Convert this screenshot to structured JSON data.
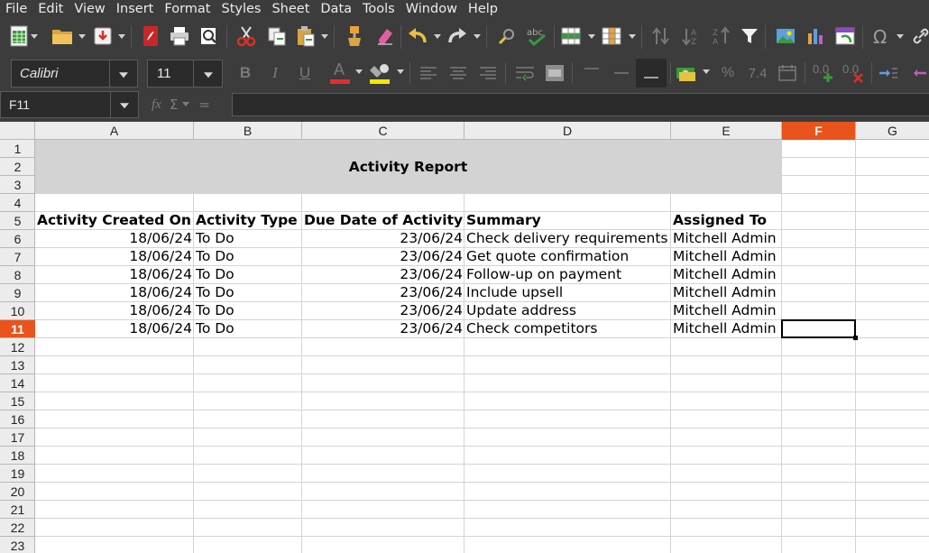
{
  "menu": [
    "File",
    "Edit",
    "View",
    "Insert",
    "Format",
    "Styles",
    "Sheet",
    "Data",
    "Tools",
    "Window",
    "Help"
  ],
  "toolbar": {
    "font_name": "Calibri",
    "font_size": "11",
    "bold": "B",
    "italic": "I",
    "underline": "U",
    "font_color_letter": "A",
    "font_color": "#e0302d",
    "highlight_color": "#f6e600",
    "currency": "%",
    "decimal": "7.4",
    "add_decimal": "0.0",
    "remove_decimal": "0.0"
  },
  "formula_bar": {
    "name_box": "F11",
    "fx": "fx",
    "sum": "Σ",
    "equals": "=",
    "content": ""
  },
  "columns": [
    "A",
    "B",
    "C",
    "D",
    "E",
    "F",
    "G"
  ],
  "selected_column": "F",
  "rows": [
    "1",
    "2",
    "3",
    "4",
    "5",
    "6",
    "7",
    "8",
    "9",
    "10",
    "11",
    "12",
    "13",
    "14",
    "15",
    "16",
    "17",
    "18",
    "19",
    "20",
    "21",
    "22",
    "23"
  ],
  "selected_row": "11",
  "sheet": {
    "title": "Activity Report",
    "headers": [
      "Activity Created On",
      "Activity Type",
      "Due Date of Activity",
      "Summary",
      "Assigned To"
    ],
    "records": [
      [
        "18/06/24",
        "To Do",
        "23/06/24",
        "Check delivery requirements",
        "Mitchell Admin"
      ],
      [
        "18/06/24",
        "To Do",
        "23/06/24",
        "Get quote confirmation",
        "Mitchell Admin"
      ],
      [
        "18/06/24",
        "To Do",
        "23/06/24",
        "Follow-up on payment",
        "Mitchell Admin"
      ],
      [
        "18/06/24",
        "To Do",
        "23/06/24",
        "Include upsell",
        "Mitchell Admin"
      ],
      [
        "18/06/24",
        "To Do",
        "23/06/24",
        "Update address",
        "Mitchell Admin"
      ],
      [
        "18/06/24",
        "To Do",
        "23/06/24",
        "Check competitors",
        "Mitchell Admin"
      ]
    ]
  },
  "colors": {
    "selection_header": "#e9541c",
    "title_band": "#d3d3d3",
    "chrome": "#3c3c3c"
  }
}
